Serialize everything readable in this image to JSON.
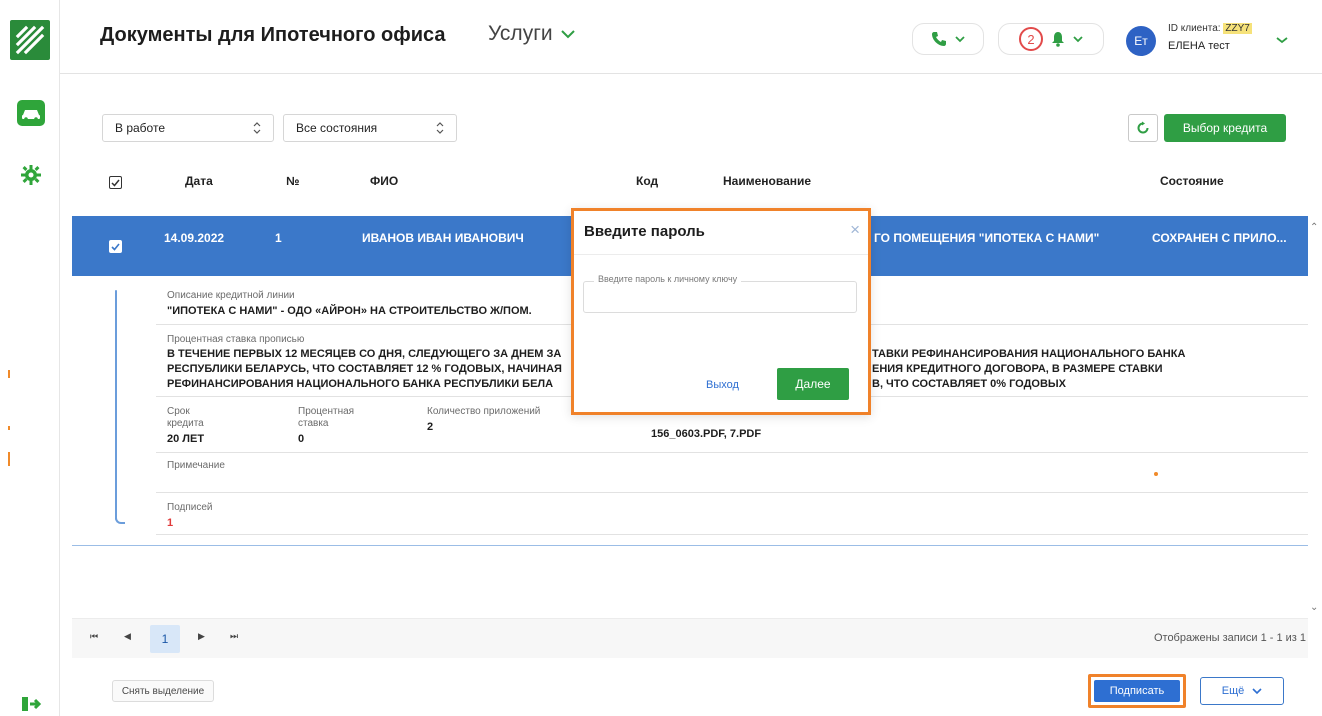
{
  "header": {
    "title": "Документы для Ипотечного офиса",
    "services_label": "Услуги",
    "notifications_count": "2",
    "avatar_initials": "Ет",
    "client_id_label": "ID клиента:",
    "client_id_value": "ZZY7",
    "user_name": "ЕЛЕНА тест"
  },
  "filters": {
    "status_select": "В работе",
    "state_select": "Все состояния",
    "select_credit_button": "Выбор кредита"
  },
  "table": {
    "columns": {
      "date": "Дата",
      "number": "№",
      "fio": "ФИО",
      "code": "Код",
      "name": "Наименование",
      "state": "Состояние"
    },
    "row": {
      "date": "14.09.2022",
      "number": "1",
      "fio": "ИВАНОВ ИВАН ИВАНОВИЧ",
      "name_visible": "ГО ПОМЕЩЕНИЯ \"ИПОТЕКА С НАМИ\"",
      "state": "СОХРАНЕН С ПРИЛО..."
    }
  },
  "detail": {
    "credit_line_label": "Описание кредитной линии",
    "credit_line_value": "\"ИПОТЕКА С НАМИ\" - ОДО «АЙРОН» НА СТРОИТЕЛЬСТВО Ж/ПОМ.",
    "rate_text_label": "Процентная ставка прописью",
    "rate_left_lines": [
      "В ТЕЧЕНИЕ ПЕРВЫХ 12 МЕСЯЦЕВ СО ДНЯ, СЛЕДУЮЩЕГО ЗА ДНЕМ ЗА",
      "РЕСПУБЛИКИ БЕЛАРУСЬ, ЧТО СОСТАВЛЯЕТ 12 % ГОДОВЫХ, НАЧИНАЯ",
      "РЕФИНАНСИРОВАНИЯ НАЦИОНАЛЬНОГО БАНКА РЕСПУБЛИКИ БЕЛА"
    ],
    "rate_right_lines": [
      "ТАВКИ РЕФИНАНСИРОВАНИЯ НАЦИОНАЛЬНОГО БАНКА",
      "ЕНИЯ КРЕДИТНОГО ДОГОВОРА, В РАЗМЕРЕ СТАВКИ",
      "В, ЧТО СОСТАВЛЯЕТ 0% ГОДОВЫХ"
    ],
    "term_label_line1": "Срок",
    "term_label_line2": "кредита",
    "term_value": "20 ЛЕТ",
    "rate_label_line1": "Процентная",
    "rate_label_line2": "ставка",
    "rate_value": "0",
    "attachments_label": "Количество приложений",
    "attachments_value": "2",
    "files_value": "156_0603.PDF, 7.PDF",
    "note_label": "Примечание",
    "signatures_label": "Подписей",
    "signatures_value": "1"
  },
  "pager": {
    "current_page": "1",
    "info": "Отображены записи 1 - 1 из 1"
  },
  "footer": {
    "clear_selection": "Снять выделение",
    "sign_button": "Подписать",
    "more_button": "Ещё"
  },
  "modal": {
    "title": "Введите пароль",
    "field_label": "Введите пароль к личному ключу",
    "exit_link": "Выход",
    "next_button": "Далее"
  },
  "colors": {
    "brand_green": "#2f9e44",
    "selected_row_blue": "#3b78c9",
    "highlight_orange": "#f0822a"
  }
}
